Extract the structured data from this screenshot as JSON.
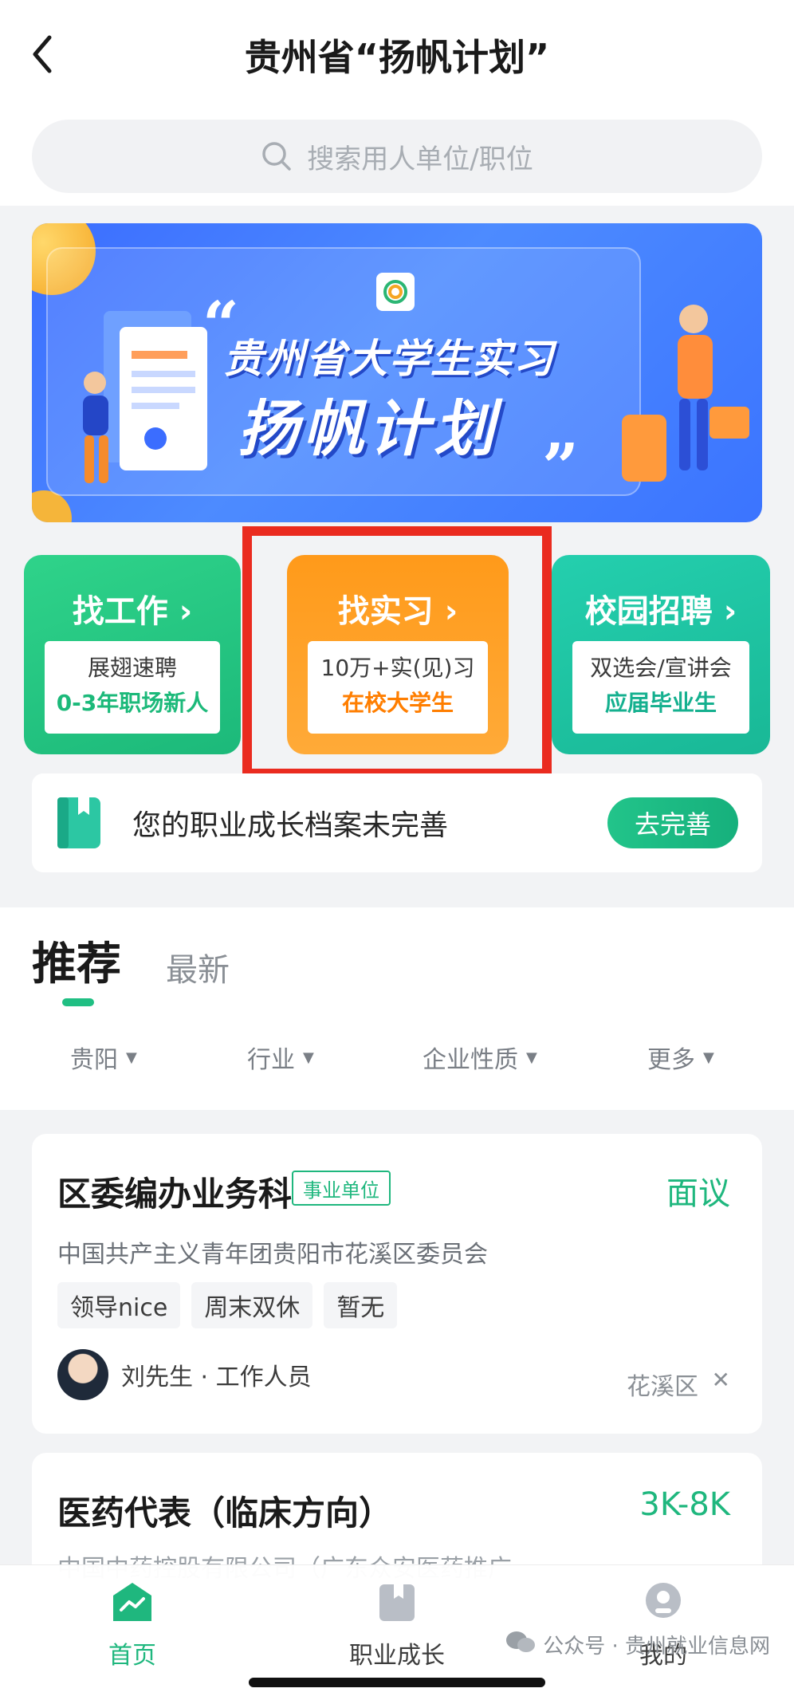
{
  "header": {
    "title": "贵州省“扬帆计划”"
  },
  "search": {
    "placeholder": "搜索用人单位/职位"
  },
  "banner": {
    "line1": "贵州省大学生实习",
    "line2": "扬帆计划"
  },
  "entries": [
    {
      "title": "找工作 ›",
      "line1": "展翅速聘",
      "line2": "0-3年职场新人"
    },
    {
      "title": "找实习 ›",
      "line1": "10万+实(见)习",
      "line2": "在校大学生"
    },
    {
      "title": "校园招聘 ›",
      "line1": "双选会/宣讲会",
      "line2": "应届毕业生"
    }
  ],
  "profile": {
    "text": "您的职业成长档案未完善",
    "button": "去完善"
  },
  "tabs": {
    "recommend": "推荐",
    "latest": "最新"
  },
  "filters": [
    "贵阳",
    "行业",
    "企业性质",
    "更多"
  ],
  "jobs": [
    {
      "title": "区委编办业务科",
      "tag": "事业单位",
      "salary": "面议",
      "company": "中国共产主义青年团贵阳市花溪区委员会",
      "tags": [
        "领导nice",
        "周末双休",
        "暂无"
      ],
      "recruiter": "刘先生 · 工作人员",
      "district": "花溪区"
    },
    {
      "title": "医药代表（临床方向）",
      "salary": "3K-8K",
      "company": "中国中药控股有限公司（广东众安医药推广"
    }
  ],
  "nav": {
    "home": "首页",
    "growth": "职业成长",
    "mine": "我的"
  },
  "watermark": "公众号 · 贵州就业信息网",
  "colors": {
    "brand_green": "#1fb77e",
    "orange": "#ff9a1a",
    "highlight_red": "#ea2b1f",
    "banner_blue": "#4d8bff"
  }
}
